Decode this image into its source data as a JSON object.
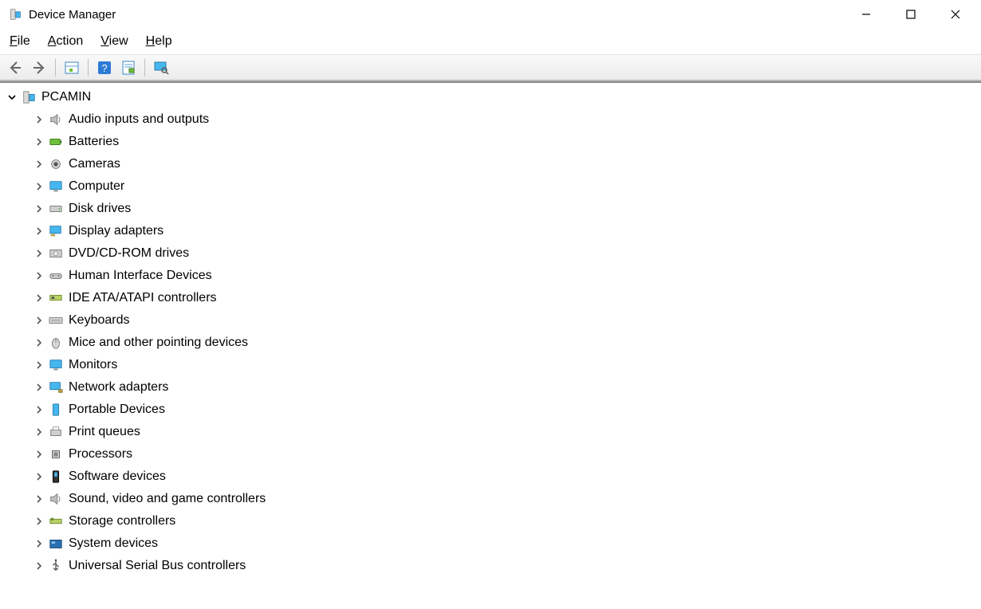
{
  "window": {
    "title": "Device Manager",
    "minimize": "Minimize",
    "maximize": "Maximize",
    "close": "Close"
  },
  "menu": {
    "file": "File",
    "action": "Action",
    "view": "View",
    "help": "Help"
  },
  "toolbar": {
    "items": [
      {
        "name": "back-icon"
      },
      {
        "name": "forward-icon"
      },
      {
        "sep": true
      },
      {
        "name": "show-hidden-icon"
      },
      {
        "sep": true
      },
      {
        "name": "help-icon"
      },
      {
        "name": "properties-icon"
      },
      {
        "sep": true
      },
      {
        "name": "scan-hardware-icon"
      }
    ]
  },
  "tree": {
    "root": {
      "label": "PCAMIN",
      "expanded": true
    },
    "items": [
      {
        "icon": "speaker-icon",
        "label": "Audio inputs and outputs"
      },
      {
        "icon": "battery-icon",
        "label": "Batteries"
      },
      {
        "icon": "camera-icon",
        "label": "Cameras"
      },
      {
        "icon": "monitor-icon",
        "label": "Computer"
      },
      {
        "icon": "disk-icon",
        "label": "Disk drives"
      },
      {
        "icon": "display-adapter-icon",
        "label": "Display adapters"
      },
      {
        "icon": "dvd-icon",
        "label": "DVD/CD-ROM drives"
      },
      {
        "icon": "hid-icon",
        "label": "Human Interface Devices"
      },
      {
        "icon": "ide-icon",
        "label": "IDE ATA/ATAPI controllers"
      },
      {
        "icon": "keyboard-icon",
        "label": "Keyboards"
      },
      {
        "icon": "mouse-icon",
        "label": "Mice and other pointing devices"
      },
      {
        "icon": "monitor-icon",
        "label": "Monitors"
      },
      {
        "icon": "network-icon",
        "label": "Network adapters"
      },
      {
        "icon": "portable-icon",
        "label": "Portable Devices"
      },
      {
        "icon": "printer-icon",
        "label": "Print queues"
      },
      {
        "icon": "processor-icon",
        "label": "Processors"
      },
      {
        "icon": "software-icon",
        "label": "Software devices"
      },
      {
        "icon": "speaker-icon",
        "label": "Sound, video and game controllers"
      },
      {
        "icon": "storage-icon",
        "label": "Storage controllers"
      },
      {
        "icon": "system-icon",
        "label": "System devices"
      },
      {
        "icon": "usb-icon",
        "label": "Universal Serial Bus controllers"
      }
    ]
  }
}
